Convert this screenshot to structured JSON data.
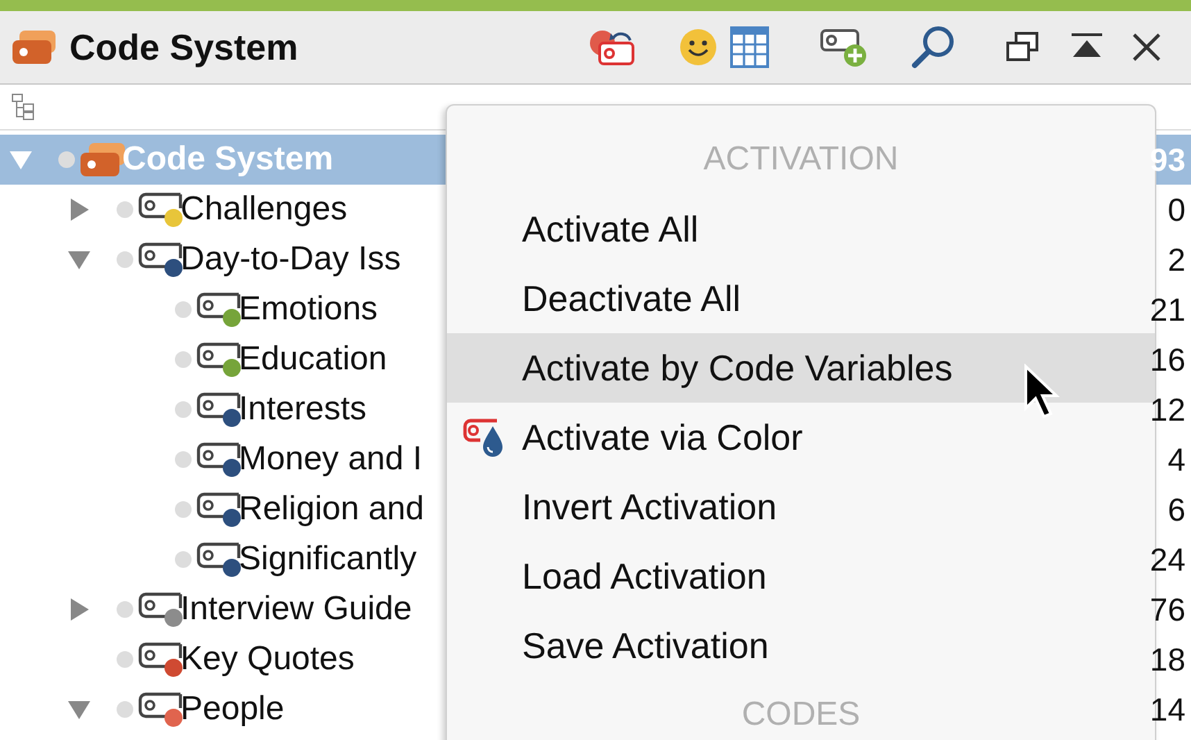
{
  "window": {
    "title": "Code System"
  },
  "tree": [
    {
      "label": "Code System",
      "count": "93",
      "selected": true,
      "expanded": true,
      "kind": "root",
      "children": [
        {
          "label": "Challenges",
          "count": "0",
          "color": "#e8c53a",
          "expanded": false,
          "selected": false,
          "kind": "code"
        },
        {
          "label": "Day-to-Day Iss",
          "count": "2",
          "color": "#2d4f7e",
          "expanded": true,
          "selected": false,
          "kind": "code",
          "children": [
            {
              "label": "Emotions",
              "count": "21",
              "color": "#76a43a",
              "selected": false,
              "kind": "code"
            },
            {
              "label": "Education",
              "count": "16",
              "color": "#76a43a",
              "selected": false,
              "kind": "code"
            },
            {
              "label": "Interests",
              "count": "12",
              "color": "#2d4f7e",
              "selected": false,
              "kind": "code"
            },
            {
              "label": "Money and I",
              "count": "4",
              "color": "#2d4f7e",
              "selected": false,
              "kind": "code"
            },
            {
              "label": "Religion and",
              "count": "6",
              "color": "#2d4f7e",
              "selected": false,
              "kind": "code"
            },
            {
              "label": "Significantly",
              "count": "24",
              "color": "#2d4f7e",
              "selected": false,
              "kind": "code"
            }
          ]
        },
        {
          "label": "Interview Guide",
          "count": "76",
          "color": "#8c8c8c",
          "expanded": false,
          "selected": false,
          "kind": "code"
        },
        {
          "label": "Key Quotes",
          "count": "18",
          "color": "#cf4a32",
          "selected": false,
          "kind": "code"
        },
        {
          "label": "People",
          "count": "14",
          "color": "#e0644e",
          "expanded": true,
          "selected": false,
          "kind": "code"
        }
      ]
    }
  ],
  "menu": {
    "sections": [
      {
        "title": "ACTIVATION",
        "items": [
          {
            "label": "Activate All",
            "selected": false,
            "kind": "plain"
          },
          {
            "label": "Deactivate All",
            "selected": false,
            "kind": "plain"
          },
          {
            "label": "Activate by Code Variables",
            "selected": true,
            "kind": "plain"
          },
          {
            "label": "Activate via Color",
            "selected": false,
            "kind": "color"
          },
          {
            "label": "Invert Activation",
            "selected": false,
            "kind": "plain"
          },
          {
            "label": "Load Activation",
            "selected": false,
            "kind": "plain"
          },
          {
            "label": "Save Activation",
            "selected": false,
            "kind": "plain"
          }
        ]
      },
      {
        "title": "CODES"
      }
    ]
  }
}
